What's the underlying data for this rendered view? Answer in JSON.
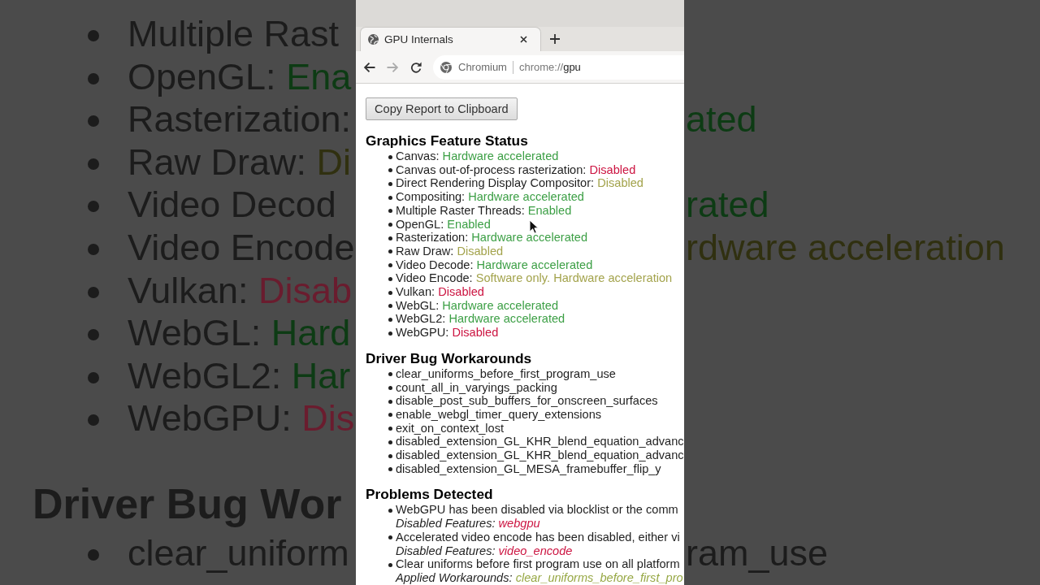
{
  "browser": {
    "tabs": [
      {
        "title": "GPU Internals",
        "selected": true
      }
    ],
    "nav_buttons": [
      {
        "kind": "back",
        "disabled": false
      },
      {
        "kind": "forward",
        "disabled": true
      },
      {
        "kind": "reload",
        "disabled": false
      }
    ],
    "omnibox": {
      "site_label": "Chromium",
      "url_scheme": "chrome://",
      "url_host": "gpu"
    }
  },
  "page": {
    "copy_button": "Copy Report to Clipboard",
    "sections": [
      {
        "kind": "features",
        "title": "Graphics Feature Status",
        "items": [
          {
            "name": "Canvas:",
            "status": "Hardware accelerated",
            "color": "#3c9f45"
          },
          {
            "name": "Canvas out-of-process rasterization:",
            "status": "Disabled",
            "color": "#cc1441"
          },
          {
            "name": "Direct Rendering Display Compositor:",
            "status": "Disabled",
            "color": "#a3a34c"
          },
          {
            "name": "Compositing:",
            "status": "Hardware accelerated",
            "color": "#3c9f45"
          },
          {
            "name": "Multiple Raster Threads:",
            "status": "Enabled",
            "color": "#3c9f45"
          },
          {
            "name": "OpenGL:",
            "status": "Enabled",
            "color": "#3c9f45"
          },
          {
            "name": "Rasterization:",
            "status": "Hardware accelerated",
            "color": "#3c9f45"
          },
          {
            "name": "Raw Draw:",
            "status": "Disabled",
            "color": "#a3a34c"
          },
          {
            "name": "Video Decode:",
            "status": "Hardware accelerated",
            "color": "#3c9f45"
          },
          {
            "name": "Video Encode:",
            "status": "Software only. Hardware acceleration",
            "color": "#a3a34c"
          },
          {
            "name": "Vulkan:",
            "status": "Disabled",
            "color": "#cc1441"
          },
          {
            "name": "WebGL:",
            "status": "Hardware accelerated",
            "color": "#3c9f45"
          },
          {
            "name": "WebGL2:",
            "status": "Hardware accelerated",
            "color": "#3c9f45"
          },
          {
            "name": "WebGPU:",
            "status": "Disabled",
            "color": "#cc1441"
          }
        ]
      },
      {
        "kind": "workarounds",
        "title": "Driver Bug Workarounds",
        "items": [
          "clear_uniforms_before_first_program_use",
          "count_all_in_varyings_packing",
          "disable_post_sub_buffers_for_onscreen_surfaces",
          "enable_webgl_timer_query_extensions",
          "exit_on_context_lost",
          "disabled_extension_GL_KHR_blend_equation_advanc",
          "disabled_extension_GL_KHR_blend_equation_advanc",
          "disabled_extension_GL_MESA_framebuffer_flip_y"
        ]
      },
      {
        "kind": "problems",
        "title": "Problems Detected",
        "items": [
          {
            "description": "WebGPU has been disabled via blocklist or the comm",
            "detail_label": "Disabled Features:",
            "detail_value": "webgpu",
            "color": "#cc1441"
          },
          {
            "description": "Accelerated video encode has been disabled, either vi",
            "detail_label": "Disabled Features:",
            "detail_value": "video_encode",
            "color": "#cc1441"
          },
          {
            "description": "Clear uniforms before first program use on all platform",
            "detail_label": "Applied Workarounds:",
            "detail_value": "clear_uniforms_before_first_pro",
            "color": "#97a845"
          }
        ]
      }
    ]
  },
  "backdrop": {
    "lines": [
      {
        "kind": "item",
        "name": "Multiple Rast"
      },
      {
        "kind": "item",
        "name": "OpenGL:",
        "status": "Ena",
        "color": "#0d3b14"
      },
      {
        "kind": "item",
        "name": "Rasterization:",
        "right": {
          "text": "ated",
          "color": "#0d3b14"
        }
      },
      {
        "kind": "item",
        "name": "Raw Draw:",
        "status": "Di",
        "color": "#303010"
      },
      {
        "kind": "item",
        "name": "Video Decod",
        "right": {
          "text": "rated",
          "color": "#0d3b14"
        }
      },
      {
        "kind": "item",
        "name": "Video Encode",
        "right": {
          "text": "rdware acceleration",
          "color": "#303010"
        }
      },
      {
        "kind": "item",
        "name": "Vulkan:",
        "status": "Disab",
        "color": "#6a1c2e"
      },
      {
        "kind": "item",
        "name": "WebGL:",
        "status": "Hard",
        "color": "#0d3b14"
      },
      {
        "kind": "item",
        "name": "WebGL2:",
        "status": "Har",
        "color": "#0d3b14"
      },
      {
        "kind": "item",
        "name": "WebGPU:",
        "status": "Dis",
        "color": "#6a1c2e"
      },
      {
        "kind": "heading",
        "name": "Driver Bug Wor"
      },
      {
        "kind": "item",
        "name": "clear_uniform",
        "right": {
          "text": "ram_use"
        }
      }
    ]
  }
}
